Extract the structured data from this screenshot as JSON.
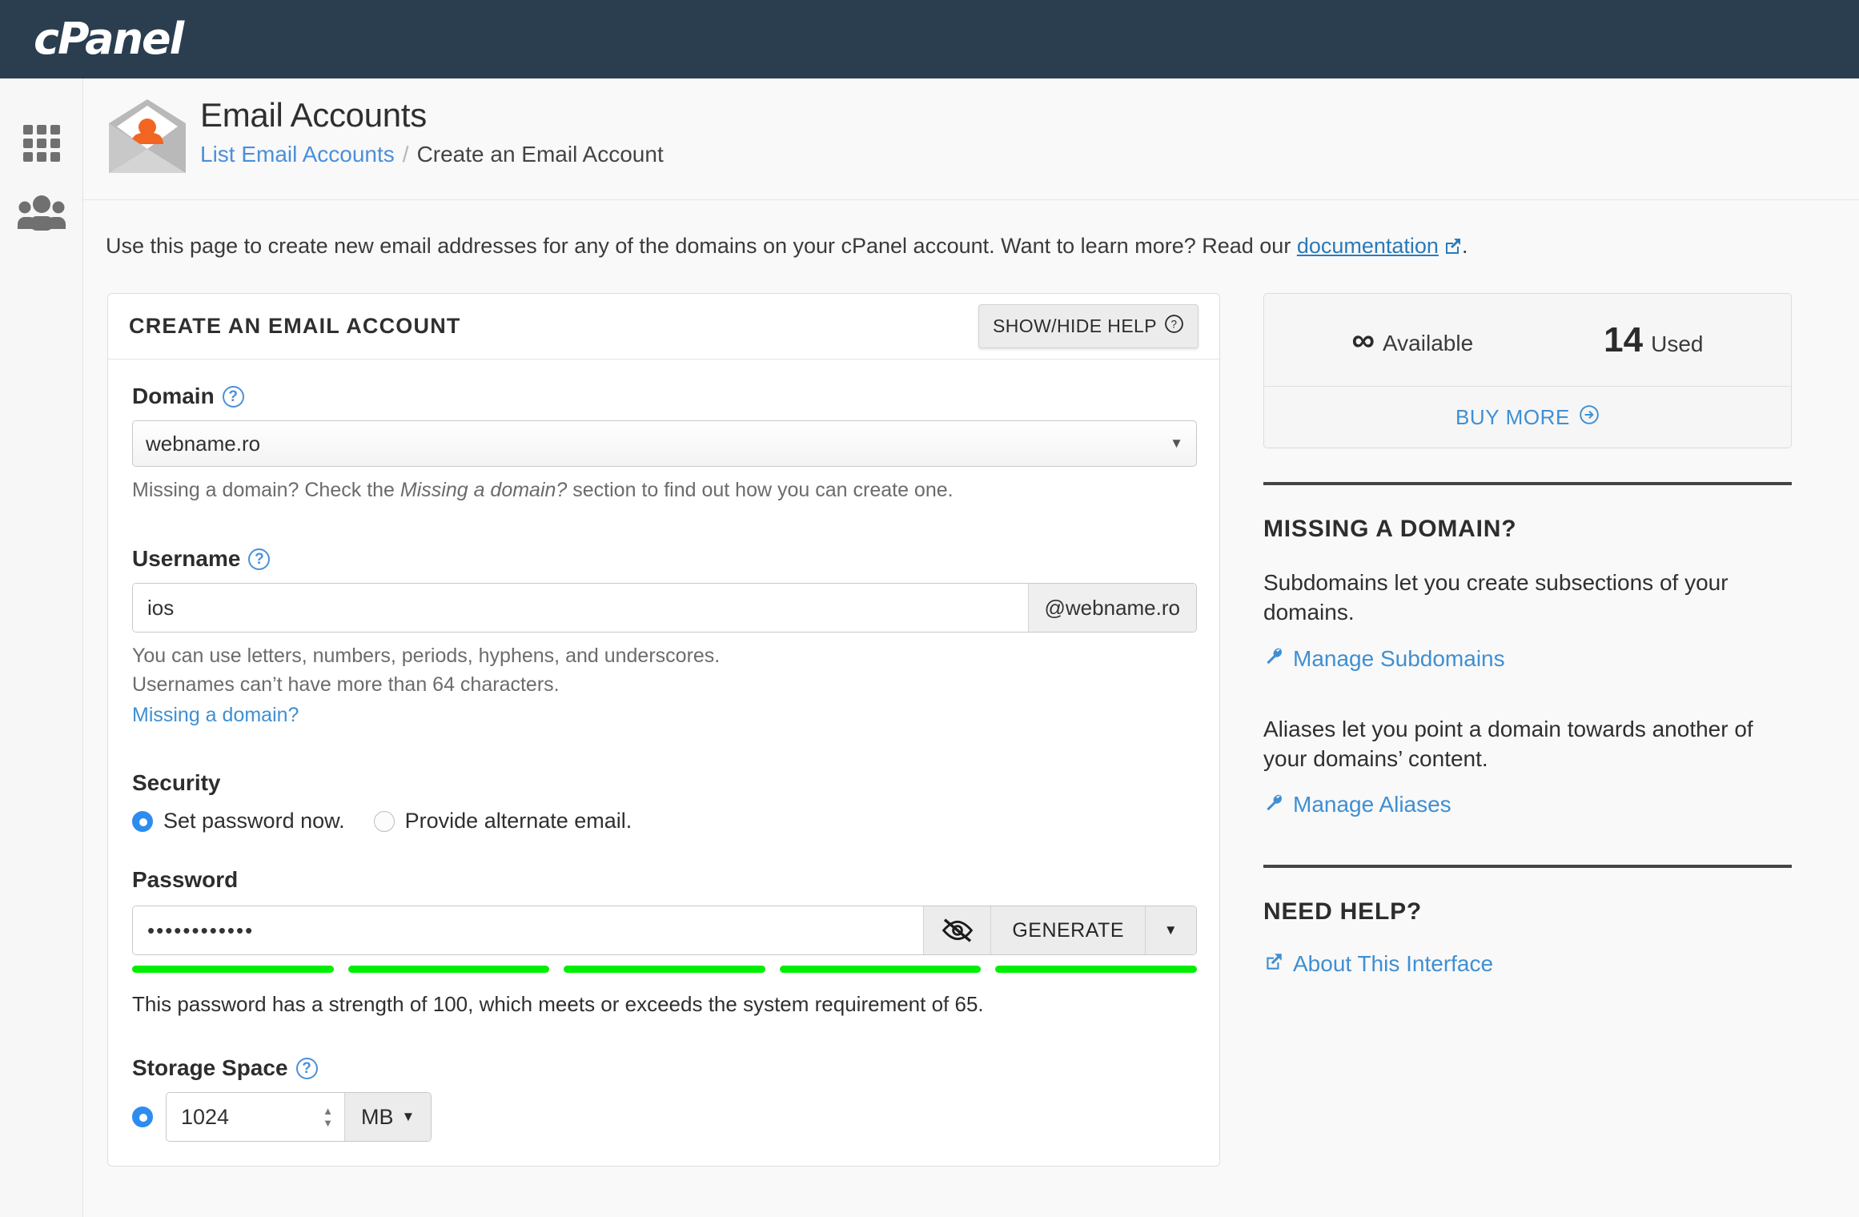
{
  "topbar": {
    "brand": "cPanel"
  },
  "sidebar": {
    "items": [
      {
        "name": "apps-grid",
        "icon": "grid-icon"
      },
      {
        "name": "user-manager",
        "icon": "users-icon"
      }
    ]
  },
  "page": {
    "title": "Email Accounts",
    "icon": "email-account-envelope-icon",
    "breadcrumb": {
      "link": "List Email Accounts",
      "separator": "/",
      "current": "Create an Email Account"
    },
    "intro_prefix": "Use this page to create new email addresses for any of the domains on your cPanel account. Want to learn more? Read our ",
    "intro_link": "documentation",
    "intro_suffix": "."
  },
  "form": {
    "card_title": "CREATE AN EMAIL ACCOUNT",
    "help_toggle": "SHOW/HIDE HELP",
    "help_toggle_icon": "question-circle-icon",
    "domain": {
      "label": "Domain",
      "help_icon": "question-circle-icon",
      "value": "webname.ro",
      "caret": "▼",
      "hint_before": "Missing a domain? Check the ",
      "hint_italic": "Missing a domain?",
      "hint_after": " section to find out how you can create one."
    },
    "username": {
      "label": "Username",
      "help_icon": "question-circle-icon",
      "value": "ios",
      "placeholder": "",
      "addon": "@webname.ro",
      "hint1": "You can use letters, numbers, periods, hyphens, and underscores.",
      "hint2": "Usernames can’t have more than 64 characters.",
      "link": "Missing a domain?"
    },
    "security": {
      "label": "Security",
      "options": [
        {
          "label": "Set password now.",
          "selected": true
        },
        {
          "label": "Provide alternate email.",
          "selected": false
        }
      ]
    },
    "password": {
      "label": "Password",
      "value": "••••••••••••",
      "eye_icon": "eye-slash-icon",
      "generate_label": "GENERATE",
      "dropdown_caret": "▼",
      "strength_bars": 5,
      "strength_color": "#00ee00",
      "strength_message": "This password has a strength of 100, which meets or exceeds the system requirement of 65."
    },
    "storage": {
      "label": "Storage Space",
      "help_icon": "question-circle-icon",
      "radio_selected": true,
      "value": "1024",
      "unit": "MB",
      "unit_caret": "▼",
      "spinner_up": "▲",
      "spinner_down": "▼"
    }
  },
  "side": {
    "stats": {
      "available_value": "∞",
      "available_label": "Available",
      "used_value": "14",
      "used_label": "Used",
      "buy_more": "BUY MORE",
      "buy_more_icon": "arrow-circle-right-icon"
    },
    "missing_domain": {
      "heading": "MISSING A DOMAIN?",
      "paragraph1": "Subdomains let you create subsections of your domains.",
      "link1": "Manage Subdomains",
      "link1_icon": "wrench-icon",
      "paragraph2": "Aliases let you point a domain towards another of your domains’ content.",
      "link2": "Manage Aliases",
      "link2_icon": "wrench-icon"
    },
    "need_help": {
      "heading": "NEED HELP?",
      "link": "About This Interface",
      "link_icon": "external-link-icon"
    }
  },
  "colors": {
    "brand_dark": "#2b3e50",
    "accent_blue": "#3f8fd2",
    "radio_blue": "#2d8cf0",
    "strength_green": "#00ee00",
    "icon_orange": "#f26522"
  }
}
